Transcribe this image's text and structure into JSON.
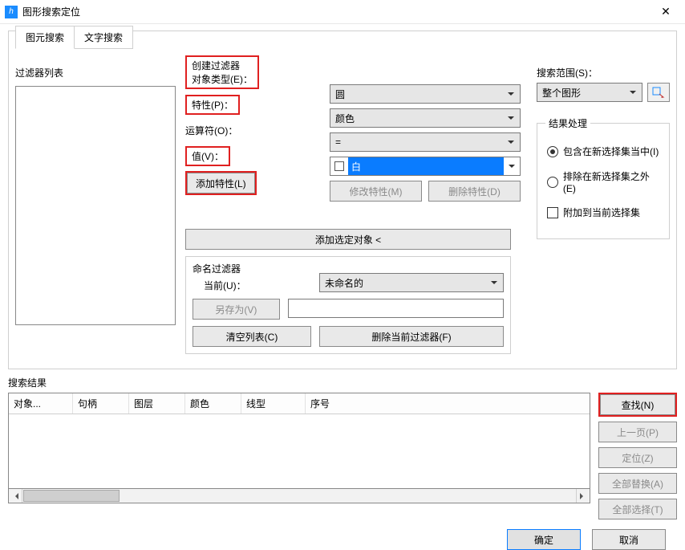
{
  "window": {
    "title": "图形搜索定位"
  },
  "tabs": {
    "primitive": "图元搜索",
    "text": "文字搜索"
  },
  "filter_list": {
    "label": "过滤器列表"
  },
  "create_filter": {
    "title": "创建过滤器",
    "obj_type_label": "对象类型(E)：",
    "obj_type_value": "圆",
    "property_label": "特性(P)：",
    "property_value": "颜色",
    "operator_label": "运算符(O)：",
    "operator_value": "=",
    "value_label": "值(V)：",
    "value_value": "白",
    "add_property": "添加特性(L)",
    "modify_property": "修改特性(M)",
    "delete_property": "删除特性(D)",
    "add_selected": "添加选定对象 <"
  },
  "named_filter": {
    "title": "命名过滤器",
    "current_label": "当前(U)：",
    "current_value": "未命名的",
    "save_as": "另存为(V)",
    "clear_list": "清空列表(C)",
    "delete_current": "删除当前过滤器(F)"
  },
  "search_scope": {
    "label": "搜索范围(S)：",
    "value": "整个图形"
  },
  "result_handling": {
    "title": "结果处理",
    "include": "包含在新选择集当中(I)",
    "exclude": "排除在新选择集之外(E)",
    "append": "附加到当前选择集"
  },
  "search_results": {
    "label": "搜索结果",
    "columns": [
      "对象...",
      "句柄",
      "图层",
      "颜色",
      "线型",
      "序号"
    ]
  },
  "side": {
    "find": "查找(N)",
    "prev": "上一页(P)",
    "locate": "定位(Z)",
    "replace_all": "全部替换(A)",
    "select_all": "全部选择(T)"
  },
  "footer": {
    "ok": "确定",
    "cancel": "取消"
  }
}
